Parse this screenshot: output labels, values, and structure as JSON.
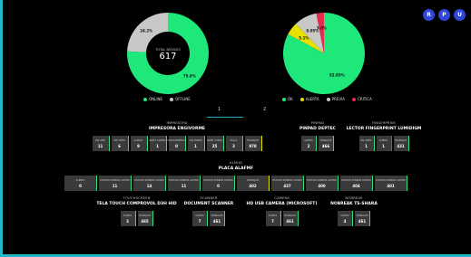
{
  "colors": {
    "green": "#1ee87a",
    "grey": "#c8c8c8",
    "red": "#e82a4e",
    "yellow": "#e8e100",
    "accent": "#2f46d8"
  },
  "topbar": {
    "buttons": [
      "R",
      "P",
      "U"
    ]
  },
  "chart_data": [
    {
      "type": "pie",
      "hole": true,
      "center_label": "TOTAL DEVICES",
      "center_value": "617",
      "slices": [
        {
          "name": "Online",
          "value": 75.8,
          "label": "75.8%",
          "color": "#1ee87a"
        },
        {
          "name": "Offline",
          "value": 24.2,
          "label": "24.2%",
          "color": "#c8c8c8"
        }
      ],
      "legend": [
        "ONLINE",
        "OFFLINE"
      ]
    },
    {
      "type": "pie",
      "slices": [
        {
          "name": "OK",
          "value": 82.85,
          "label": "82.85%",
          "color": "#1ee87a"
        },
        {
          "name": "Warning",
          "value": 5.1,
          "label": "5.1%",
          "color": "#e8e100"
        },
        {
          "name": "Unknown",
          "value": 9.05,
          "label": "9.05%",
          "color": "#c8c8c8"
        },
        {
          "name": "Critical",
          "value": 3,
          "label": "3.0%",
          "color": "#e82a4e"
        }
      ],
      "legend": [
        "OK",
        "ALERTA",
        "PREVIA",
        "CRITICA"
      ]
    }
  ],
  "tabs": [
    "1",
    "2"
  ],
  "groups": [
    {
      "cat": "IMPRESORA",
      "name": "IMPRESORA ENGIVORME",
      "cards": [
        {
          "l": "ON LINE",
          "v": "11",
          "c": ""
        },
        {
          "l": "SIN TINTA",
          "v": "6",
          "c": ""
        },
        {
          "l": "ALERTA",
          "v": "9",
          "c": ""
        },
        {
          "l": "PAPEL ALERTA",
          "v": "1",
          "c": ""
        },
        {
          "l": "ATASCAMIENTO",
          "v": "0",
          "c": ""
        },
        {
          "l": "SIN TONER",
          "v": "1",
          "c": ""
        },
        {
          "l": "PAPEL FUERA",
          "v": "25",
          "c": ""
        },
        {
          "l": "FALLA",
          "v": "3",
          "c": ""
        },
        {
          "l": "TRABAJOS",
          "v": "978",
          "c": "y"
        }
      ]
    },
    {
      "cat": "PINPAD",
      "name": "PINPAD DEPTEC",
      "cards": [
        {
          "l": "ALERTA",
          "v": "2",
          "c": ""
        },
        {
          "l": "TRABAJOS",
          "v": "466",
          "c": ""
        }
      ]
    },
    {
      "cat": "FINGERPRINT",
      "name": "LECTOR FINGERPRINT LUMIDIGM",
      "cards": [
        {
          "l": "EN LINEA",
          "v": "1",
          "c": ""
        },
        {
          "l": "ALERTA",
          "v": "1",
          "c": "r"
        },
        {
          "l": "TRABAJOS",
          "v": "431",
          "c": ""
        }
      ]
    },
    {
      "cat": "ALMUD",
      "name": "PLACA ALAFMF",
      "cards": [
        {
          "l": "ALERTA",
          "v": "0",
          "c": ""
        },
        {
          "l": "ESTADO SENSOR ALERTA",
          "v": "11",
          "c": ""
        },
        {
          "l": "ESTADO SENSOR ALERTA",
          "v": "14",
          "c": ""
        },
        {
          "l": "ESTADO SENSOR ALERTA",
          "v": "11",
          "c": ""
        },
        {
          "l": "ESTADO SENSOR ALERTA",
          "v": "0",
          "c": ""
        },
        {
          "l": "TRABAJOS",
          "v": "402",
          "c": "y"
        },
        {
          "l": "ESTADO SENSOR ALERTA",
          "v": "437",
          "c": ""
        },
        {
          "l": "ESTADO SENSOR ALERTA",
          "v": "400",
          "c": ""
        },
        {
          "l": "ESTADO SENSOR ALERTA",
          "v": "404",
          "c": ""
        },
        {
          "l": "ESTADO SENSOR ALERTA",
          "v": "401",
          "c": ""
        }
      ]
    },
    {
      "cat": "TOUCHSCREEN",
      "name": "TELA TOUCH COMPROVOL D3H HID",
      "cards": [
        {
          "l": "ALERTA",
          "v": "3",
          "c": ""
        },
        {
          "l": "TRABAJOS",
          "v": "465",
          "c": ""
        }
      ]
    },
    {
      "cat": "SCANNER",
      "name": "DOCUMENT SCANNER",
      "cards": [
        {
          "l": "ALERTA",
          "v": "7",
          "c": ""
        },
        {
          "l": "TRABAJOS",
          "v": "461",
          "c": ""
        }
      ]
    },
    {
      "cat": "CAMERA",
      "name": "HD USB CAMERA (MICROSOFT)",
      "cards": [
        {
          "l": "ALERTA",
          "v": "7",
          "c": ""
        },
        {
          "l": "TRABAJOS",
          "v": "461",
          "c": ""
        }
      ]
    },
    {
      "cat": "NOBREAK",
      "name": "NOBREAK TS-SHARA",
      "cards": [
        {
          "l": "ALERTA",
          "v": "4",
          "c": ""
        },
        {
          "l": "TRABAJOS",
          "v": "461",
          "c": ""
        }
      ]
    }
  ]
}
